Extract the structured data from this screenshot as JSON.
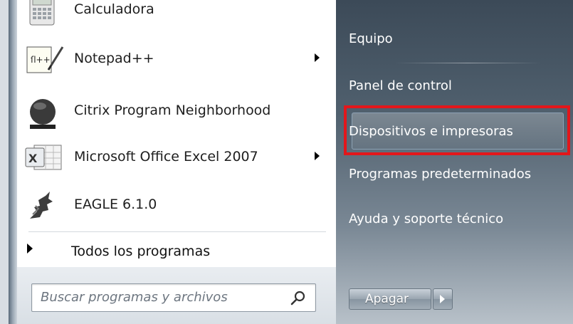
{
  "programs": [
    {
      "label": "Calculadora",
      "icon": "calculator-icon",
      "has_submenu": false
    },
    {
      "label": "Notepad++",
      "icon": "notepadpp-icon",
      "has_submenu": true
    },
    {
      "label": "Citrix Program Neighborhood",
      "icon": "citrix-icon",
      "has_submenu": false
    },
    {
      "label": "Microsoft Office Excel 2007",
      "icon": "excel-icon",
      "has_submenu": true
    },
    {
      "label": "EAGLE 6.1.0",
      "icon": "eagle-icon",
      "has_submenu": false
    }
  ],
  "all_programs_label": "Todos los programas",
  "search": {
    "placeholder": "Buscar programas y archivos",
    "icon": "search-icon"
  },
  "right_menu": {
    "items": [
      {
        "label": "Equipo"
      },
      {
        "label": "Panel de control"
      },
      {
        "label": "Dispositivos e impresoras",
        "highlighted": true
      },
      {
        "label": "Programas predeterminados"
      },
      {
        "label": "Ayuda y soporte técnico"
      }
    ]
  },
  "shutdown": {
    "label": "Apagar"
  },
  "colors": {
    "highlight_border": "#e3161b",
    "right_panel": "#4a5866"
  }
}
